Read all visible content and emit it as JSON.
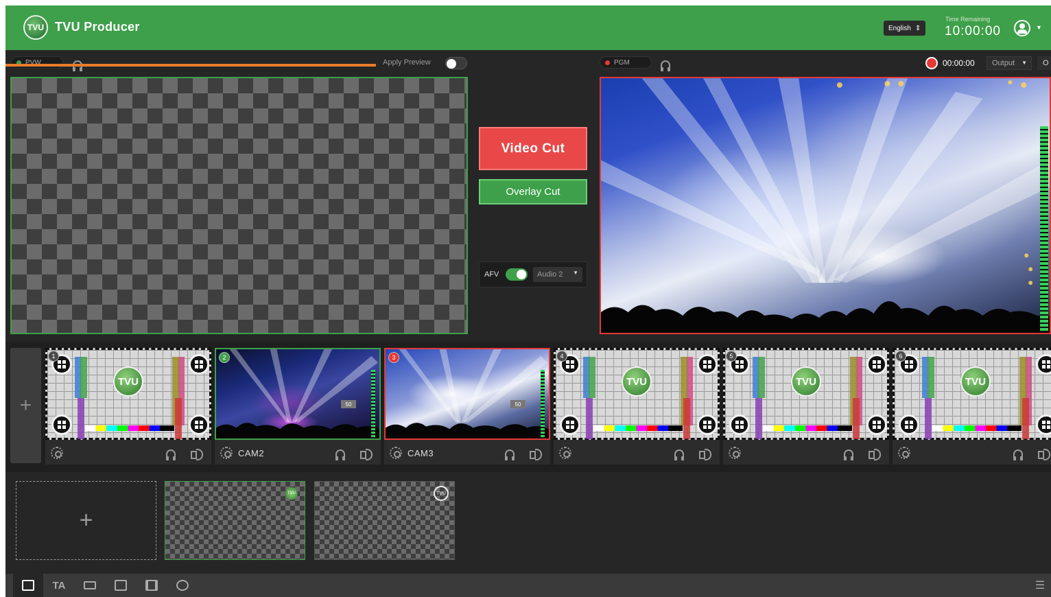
{
  "header": {
    "app_title": "TVU Producer",
    "logo_text": "TVU",
    "language": "English",
    "time_remaining_label": "Time Remaining",
    "time_remaining_value": "10:00:00"
  },
  "preview": {
    "label": "PVW",
    "apply_preview_label": "Apply Preview",
    "apply_preview_on": false
  },
  "program": {
    "label": "PGM",
    "record_time": "00:00:00",
    "output_label": "Output",
    "extra_label": "O"
  },
  "cut": {
    "video_cut_label": "Video Cut",
    "overlay_cut_label": "Overlay Cut",
    "afv_label": "AFV",
    "afv_on": true,
    "audio_select_value": "Audio 2"
  },
  "sources": [
    {
      "number": "1",
      "name": "",
      "type": "testcard"
    },
    {
      "number": "2",
      "name": "CAM2",
      "type": "concert",
      "badge": "50"
    },
    {
      "number": "3",
      "name": "CAM3",
      "type": "crowd",
      "badge": "50"
    },
    {
      "number": "4",
      "name": "",
      "type": "testcard"
    },
    {
      "number": "5",
      "name": "",
      "type": "testcard"
    },
    {
      "number": "6",
      "name": "",
      "type": "testcard"
    }
  ],
  "overlays": [
    {
      "logo_text": "TVU"
    },
    {
      "logo_text": "TVU"
    }
  ],
  "colors": {
    "brand_green": "#3ea04a",
    "program_red": "#e53935",
    "timeline_orange": "#e87d2b"
  },
  "toolbar": {
    "items": [
      "image-icon",
      "text-icon",
      "layers-icon",
      "split-icon",
      "film-icon",
      "clock-icon"
    ],
    "settings_icon": "sliders-icon"
  }
}
